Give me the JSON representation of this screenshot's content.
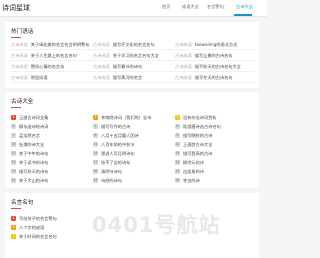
{
  "site": {
    "title": "诗词星球"
  },
  "nav": [
    "首页",
    "成语大全",
    "名言警句",
    "古诗大全"
  ],
  "hot": {
    "title": "热门语话",
    "rows": [
      [
        "古诗成语",
        "关于绿化美的名言名言明明警句"
      ],
      [
        "古诗成语",
        "描写坏文化的名言名句"
      ],
      [
        "古诗成语",
        "taoweiling的语式方式"
      ],
      [
        "古诗成语",
        "关于人生路上的名言名句"
      ],
      [
        "古诗成语",
        "关于学习的名言名句大全"
      ],
      [
        "古诗成语",
        "描写立春的古诗名句"
      ],
      [
        "古诗成语",
        "赞叹心情的名言句"
      ],
      [
        "古诗成语",
        "描写春节的诗句"
      ],
      [
        "古诗成语",
        "描写秋天的古诗名句大全"
      ],
      [
        "古诗成语",
        "明显成语"
      ],
      [
        "古诗成语",
        "描写黄河的名言"
      ],
      [
        "古诗成语",
        "描写冬天的古诗名句"
      ]
    ]
  },
  "poems": {
    "title": "古诗大全",
    "items": [
      "王维古诗词全集",
      "李商隐诗词（我们的）全诗",
      "没有杂念诗词赏析",
      "柳永送诗的诗词",
      "描写写作的古诗",
      "陆游唐诗选古诗名句",
      "孟浩然名言",
      "八月十五月圆人团诗",
      "描写晚秋的古诗",
      "杜甫的诗大全",
      "八百年前的中秋节",
      "王昌龄古诗大全",
      "关于中午的诗句",
      "我说人写月明诗句",
      "描写登高的古诗",
      "关于读书的诗句",
      "惊不了苦的诗句",
      "柳宗元的诗",
      "描写秋天的诗句",
      "清明节诗句",
      "白居易的诗",
      "关于大山的诗句",
      "诗经的诗句",
      "李白的诗"
    ]
  },
  "famous": {
    "title": "名言名句",
    "items": [
      "写给孩子的名言警句",
      "八个字的成语",
      "关于时间的名言名句"
    ]
  },
  "watermark": "0401号航站"
}
